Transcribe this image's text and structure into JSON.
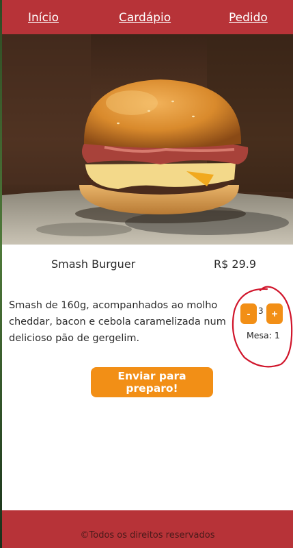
{
  "nav": {
    "home": "Início",
    "menu": "Cardápio",
    "order": "Pedido"
  },
  "product": {
    "name": "Smash Burguer",
    "price": "R$ 29.9",
    "description": "Smash de 160g, acompanhados ao molho cheddar, bacon e cebola caramelizada num delicioso pão de gergelim."
  },
  "quantity": {
    "minus_label": "-",
    "plus_label": "+",
    "value": "3",
    "table_label": "Mesa: 1"
  },
  "actions": {
    "submit_label": "Enviar para preparo!"
  },
  "footer": {
    "text": "©Todos os direitos reservados"
  },
  "colors": {
    "brand_red": "#b73338",
    "accent_orange": "#f28f16",
    "annotation_red": "#d0142a"
  },
  "icons": {
    "hero": "burger-photo"
  }
}
